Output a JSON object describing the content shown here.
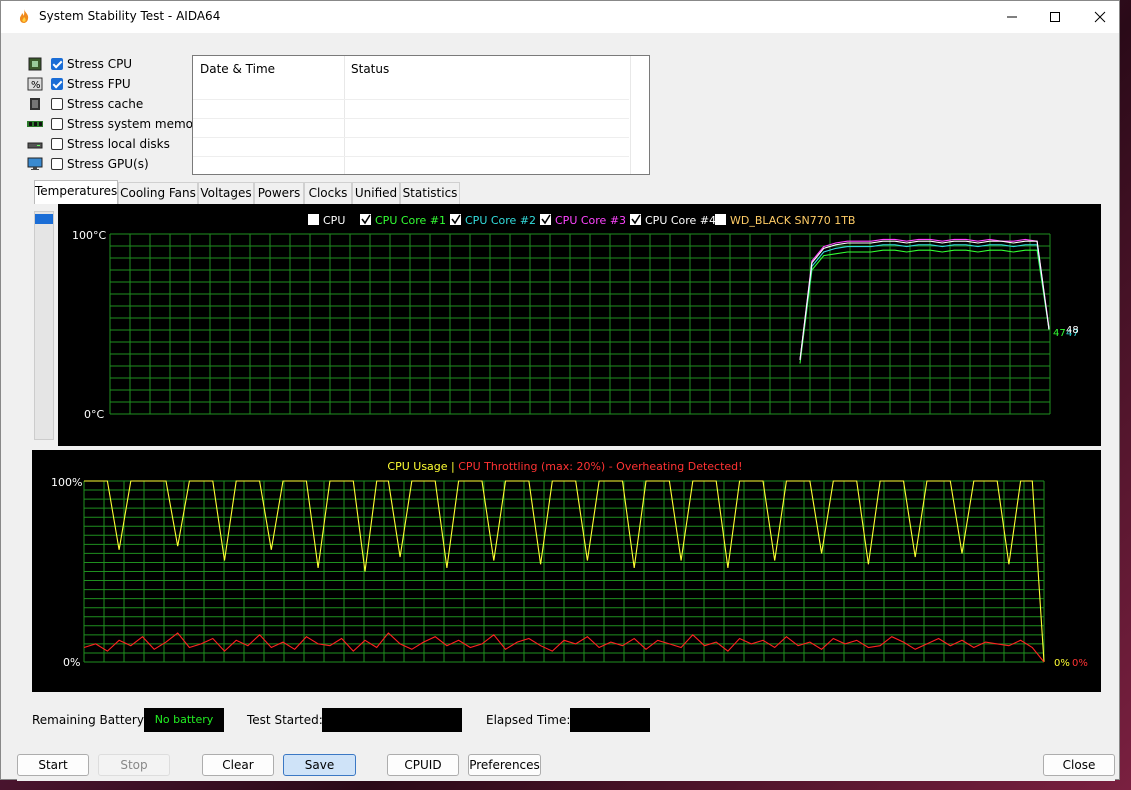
{
  "window": {
    "title": "System Stability Test - AIDA64"
  },
  "stress_options": [
    {
      "label": "Stress CPU",
      "checked": true,
      "icon": "cpu-chip-icon"
    },
    {
      "label": "Stress FPU",
      "checked": true,
      "icon": "fpu-percent-icon"
    },
    {
      "label": "Stress cache",
      "checked": false,
      "icon": "cache-chip-icon"
    },
    {
      "label": "Stress system memory",
      "checked": false,
      "icon": "memory-module-icon"
    },
    {
      "label": "Stress local disks",
      "checked": false,
      "icon": "disk-drive-icon"
    },
    {
      "label": "Stress GPU(s)",
      "checked": false,
      "icon": "monitor-icon"
    }
  ],
  "log_table": {
    "headers": [
      "Date & Time",
      "Status"
    ],
    "rows": []
  },
  "tabs": [
    "Temperatures",
    "Cooling Fans",
    "Voltages",
    "Powers",
    "Clocks",
    "Unified",
    "Statistics"
  ],
  "active_tab": "Temperatures",
  "temperature_chart": {
    "legend": [
      {
        "label": "CPU",
        "checked": false,
        "color": "#ffffff"
      },
      {
        "label": "CPU Core #1",
        "checked": true,
        "color": "#33ff33"
      },
      {
        "label": "CPU Core #2",
        "checked": true,
        "color": "#33dddd"
      },
      {
        "label": "CPU Core #3",
        "checked": true,
        "color": "#ff44ff"
      },
      {
        "label": "CPU Core #4",
        "checked": true,
        "color": "#ffffff"
      },
      {
        "label": "WD_BLACK SN770 1TB",
        "checked": false,
        "color": "#ffcc66"
      }
    ],
    "y_max_label": "100°C",
    "y_min_label": "0°C",
    "end_value_a": "47",
    "end_value_b": "47",
    "end_value_c": "48"
  },
  "cpu_chart": {
    "title_usage": "CPU Usage",
    "separator": "|",
    "title_throttle": "CPU Throttling (max: 20%) - Overheating Detected!",
    "y_max_label": "100%",
    "y_min_label": "0%",
    "end_usage": "0%",
    "end_throttle": "0%"
  },
  "chart_data": [
    {
      "type": "line",
      "title": "",
      "ylim": [
        0,
        100
      ],
      "grid": true,
      "series": [
        {
          "name": "CPU Core #1",
          "values": [
            null,
            null,
            null,
            null,
            null,
            null,
            null,
            null,
            null,
            null,
            null,
            null,
            null,
            null,
            28,
            80,
            88,
            89,
            90,
            90,
            90,
            91,
            91,
            90,
            91,
            91,
            90,
            91,
            91,
            90,
            91,
            91,
            90,
            91,
            91,
            47
          ]
        },
        {
          "name": "CPU Core #2",
          "values": [
            null,
            null,
            null,
            null,
            null,
            null,
            null,
            null,
            null,
            null,
            null,
            null,
            null,
            null,
            30,
            82,
            90,
            92,
            93,
            93,
            93,
            94,
            94,
            93,
            94,
            94,
            93,
            94,
            94,
            93,
            94,
            94,
            93,
            94,
            94,
            47
          ]
        },
        {
          "name": "CPU Core #3",
          "values": [
            null,
            null,
            null,
            null,
            null,
            null,
            null,
            null,
            null,
            null,
            null,
            null,
            null,
            null,
            30,
            85,
            93,
            95,
            96,
            96,
            96,
            97,
            97,
            96,
            97,
            97,
            96,
            97,
            97,
            96,
            97,
            96,
            96,
            97,
            96,
            48
          ]
        },
        {
          "name": "CPU Core #4",
          "values": [
            null,
            null,
            null,
            null,
            null,
            null,
            null,
            null,
            null,
            null,
            null,
            null,
            null,
            null,
            30,
            84,
            92,
            94,
            95,
            95,
            95,
            96,
            96,
            95,
            96,
            96,
            95,
            96,
            96,
            95,
            96,
            96,
            95,
            96,
            96,
            47
          ]
        }
      ]
    },
    {
      "type": "line",
      "title": "CPU Usage | CPU Throttling (max: 20%) - Overheating Detected!",
      "ylim": [
        0,
        100
      ],
      "grid": true,
      "series": [
        {
          "name": "CPU Usage",
          "values": [
            100,
            100,
            100,
            62,
            100,
            100,
            100,
            100,
            64,
            100,
            100,
            100,
            56,
            100,
            100,
            100,
            62,
            100,
            100,
            100,
            52,
            100,
            100,
            100,
            50,
            100,
            100,
            58,
            100,
            100,
            100,
            52,
            100,
            100,
            100,
            56,
            100,
            100,
            100,
            54,
            100,
            100,
            100,
            56,
            100,
            100,
            100,
            52,
            100,
            100,
            100,
            56,
            100,
            100,
            100,
            52,
            100,
            100,
            100,
            56,
            100,
            100,
            100,
            60,
            100,
            100,
            100,
            54,
            100,
            100,
            100,
            58,
            100,
            100,
            100,
            60,
            100,
            100,
            100,
            54,
            100,
            100,
            0
          ]
        },
        {
          "name": "CPU Throttling",
          "values": [
            8,
            10,
            6,
            12,
            9,
            14,
            7,
            11,
            16,
            8,
            10,
            13,
            6,
            12,
            9,
            15,
            8,
            11,
            7,
            14,
            10,
            9,
            13,
            6,
            12,
            8,
            16,
            10,
            7,
            11,
            14,
            9,
            12,
            8,
            10,
            15,
            7,
            11,
            13,
            9,
            6,
            12,
            10,
            14,
            8,
            11,
            9,
            13,
            7,
            12,
            10,
            8,
            15,
            9,
            11,
            6,
            13,
            10,
            12,
            8,
            14,
            9,
            11,
            7,
            13,
            10,
            12,
            8,
            9,
            14,
            11,
            7,
            10,
            13,
            9,
            12,
            8,
            11,
            10,
            9,
            12,
            8,
            0
          ]
        }
      ]
    }
  ],
  "footer": {
    "battery_label": "Remaining Battery:",
    "battery_value": "No battery",
    "test_started_label": "Test Started:",
    "test_started_value": "",
    "elapsed_label": "Elapsed Time:",
    "elapsed_value": ""
  },
  "buttons": {
    "start": "Start",
    "stop": "Stop",
    "clear": "Clear",
    "save": "Save",
    "cpuid": "CPUID",
    "preferences": "Preferences",
    "close": "Close"
  }
}
